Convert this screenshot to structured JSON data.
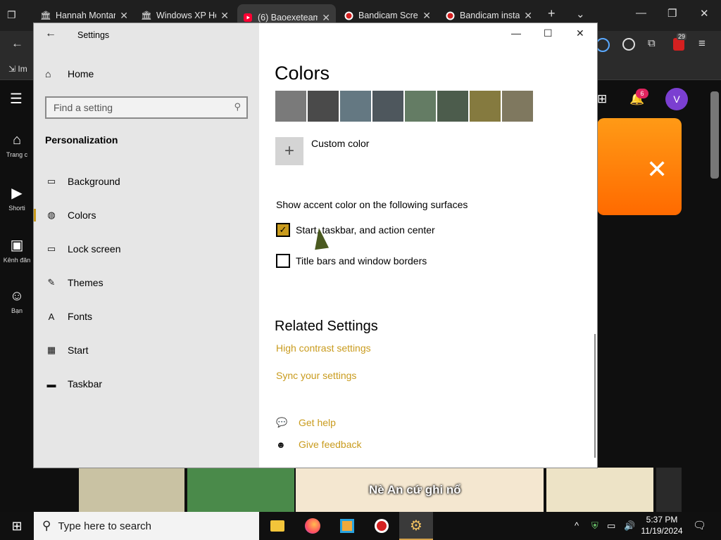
{
  "browser": {
    "tabs": [
      {
        "label": "Hannah Montar",
        "icon": "bank-icon"
      },
      {
        "label": "Windows XP Ho",
        "icon": "bank-icon"
      },
      {
        "label": "(6) Baoexeteam",
        "icon": "youtube-icon"
      },
      {
        "label": "Bandicam Scree",
        "icon": "record-icon"
      },
      {
        "label": "Bandicam instal",
        "icon": "record-icon"
      }
    ],
    "bookmark_import": "Im",
    "extension_badge": "29"
  },
  "youtube": {
    "sidebar": [
      {
        "label": "Trang c",
        "icon": "home-icon"
      },
      {
        "label": "Shorti",
        "icon": "shorts-icon"
      },
      {
        "label": "Kênh đăn",
        "icon": "subscriptions-icon"
      },
      {
        "label": "Bạn",
        "icon": "you-icon"
      }
    ],
    "notification_count": "6",
    "avatar_letter": "V",
    "thumbnail_caption": "Nè An cứ ghi nổ"
  },
  "settings": {
    "window_title": "Settings",
    "home_label": "Home",
    "search_placeholder": "Find a setting",
    "section": "Personalization",
    "nav": [
      {
        "label": "Background",
        "icon": "picture-icon"
      },
      {
        "label": "Colors",
        "icon": "palette-icon",
        "selected": true
      },
      {
        "label": "Lock screen",
        "icon": "lock-screen-icon"
      },
      {
        "label": "Themes",
        "icon": "themes-icon"
      },
      {
        "label": "Fonts",
        "icon": "fonts-icon"
      },
      {
        "label": "Start",
        "icon": "start-icon"
      },
      {
        "label": "Taskbar",
        "icon": "taskbar-icon"
      }
    ],
    "page_title": "Colors",
    "swatches": [
      "#7a7a7a",
      "#4a4a4a",
      "#647882",
      "#4e575d",
      "#647c64",
      "#4c5c4c",
      "#857a3f",
      "#7f785f"
    ],
    "custom_color_label": "Custom color",
    "surfaces_title": "Show accent color on the following surfaces",
    "checkbox_start": {
      "label": "Start, taskbar, and action center",
      "checked": true
    },
    "checkbox_titlebars": {
      "label": "Title bars and window borders",
      "checked": false
    },
    "related_title": "Related Settings",
    "links": [
      "High contrast settings",
      "Sync your settings"
    ],
    "get_help": "Get help",
    "give_feedback": "Give feedback",
    "accent_color": "#c99b1d"
  },
  "taskbar": {
    "search_placeholder": "Type here to search",
    "apps": [
      "file-explorer-icon",
      "firefox-icon",
      "windows-store-icon",
      "bandicam-icon",
      "settings-gear-icon"
    ],
    "time": "5:37 PM",
    "date": "11/19/2024"
  }
}
